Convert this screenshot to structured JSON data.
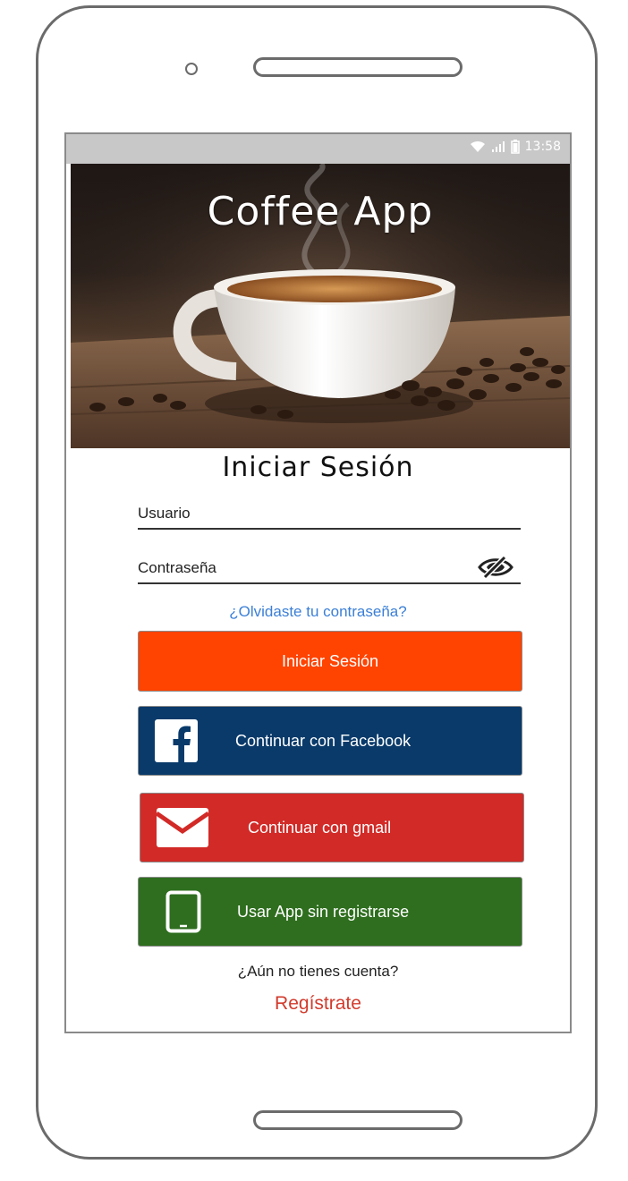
{
  "status_bar": {
    "time": "13:58",
    "icons": [
      "wifi-icon",
      "signal-icon",
      "battery-icon"
    ]
  },
  "hero": {
    "title": "Coffee App",
    "image": "coffee-cup-photo"
  },
  "login": {
    "title": "Iniciar Sesión",
    "username_label": "Usuario",
    "password_label": "Contraseña",
    "password_toggle_icon": "eye-slash-icon",
    "forgot_password": "¿Olvidaste tu contraseña?"
  },
  "buttons": {
    "login": {
      "label": "Iniciar Sesión",
      "color": "#ff4300"
    },
    "facebook": {
      "label": "Continuar con Facebook",
      "color": "#093a6a",
      "icon": "facebook-icon"
    },
    "gmail": {
      "label": "Continuar con gmail",
      "color": "#d22a27",
      "icon": "mail-icon"
    },
    "guest": {
      "label": "Usar App sin registrarse",
      "color": "#2e6e1e",
      "icon": "tablet-icon"
    }
  },
  "footer": {
    "no_account": "¿Aún no tienes cuenta?",
    "register": "Regístrate"
  },
  "colors": {
    "link": "#3b7fd6",
    "register": "#d23a2c",
    "status_bar": "#c8c8c8",
    "device_outline": "#6b6b6b"
  }
}
